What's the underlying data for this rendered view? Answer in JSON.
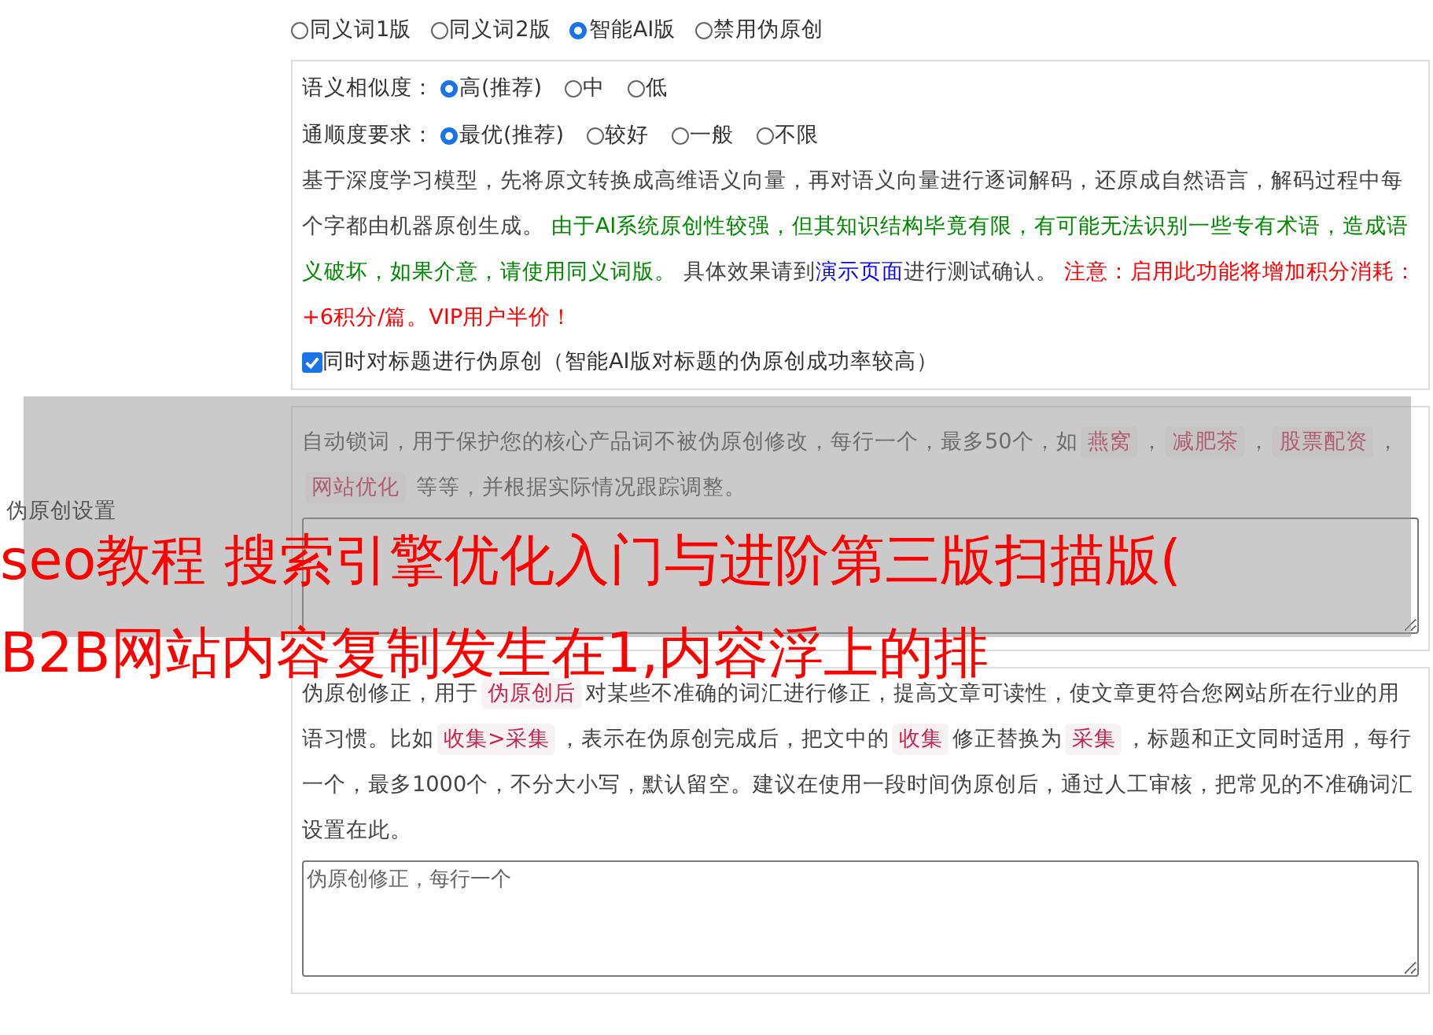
{
  "mode_options": [
    {
      "label": "同义词1版",
      "selected": false
    },
    {
      "label": "同义词2版",
      "selected": false
    },
    {
      "label": "智能AI版",
      "selected": true
    },
    {
      "label": "禁用伪原创",
      "selected": false
    }
  ],
  "similarity": {
    "label": "语义相似度：",
    "options": [
      {
        "label": "高(推荐)",
        "selected": true
      },
      {
        "label": "中",
        "selected": false
      },
      {
        "label": "低",
        "selected": false
      }
    ]
  },
  "fluency": {
    "label": "通顺度要求：",
    "options": [
      {
        "label": "最优(推荐)",
        "selected": true
      },
      {
        "label": "较好",
        "selected": false
      },
      {
        "label": "一般",
        "selected": false
      },
      {
        "label": "不限",
        "selected": false
      }
    ]
  },
  "description": [
    {
      "kind": "plain",
      "text": "基于深度学习模型，先将原文转换成高维语义向量，再对语义向量进行逐词解码，还原成自然语言，解码过程中每个字都由机器原创生成。 "
    },
    {
      "kind": "notice",
      "text": "由于AI系统原创性较强，但其知识结构毕竟有限，有可能无法识别一些专有术语，造成语义破坏，如果介意，请使用同义词版。"
    },
    {
      "kind": "plain",
      "text": " 具体效果请到"
    },
    {
      "kind": "link",
      "text": "演示页面"
    },
    {
      "kind": "plain",
      "text": "进行测试确认。 "
    },
    {
      "kind": "warning",
      "text": "注意：启用此功能将增加积分消耗：+6积分/篇。VIP用户半价！"
    }
  ],
  "title_checkbox": {
    "label": "同时对标题进行伪原创（智能AI版对标题的伪原创成功率较高）",
    "checked": true
  },
  "section_label": "伪原创设置",
  "lock_words": {
    "help": [
      {
        "kind": "plain",
        "text": "自动锁词，用于保护您的核心产品词不被伪原创修改，每行一个，最多50个，如"
      },
      {
        "kind": "tag",
        "text": "燕窝"
      },
      {
        "kind": "plain",
        "text": "，"
      },
      {
        "kind": "tag",
        "text": "减肥茶"
      },
      {
        "kind": "plain",
        "text": "，"
      },
      {
        "kind": "tag",
        "text": "股票配资"
      },
      {
        "kind": "plain",
        "text": "，"
      },
      {
        "kind": "tag",
        "text": "网站优化"
      },
      {
        "kind": "plain",
        "text": " 等等，并根据实际情况跟踪调整。"
      }
    ]
  },
  "correction": {
    "help": [
      {
        "kind": "plain",
        "text": "伪原创修正，用于"
      },
      {
        "kind": "tag",
        "text": "伪原创后"
      },
      {
        "kind": "plain",
        "text": "对某些不准确的词汇进行修正，提高文章可读性，使文章更符合您网站所在行业的用语习惯。比如"
      },
      {
        "kind": "tag",
        "text": "收集>采集"
      },
      {
        "kind": "plain",
        "text": "，表示在伪原创完成后，把文中的"
      },
      {
        "kind": "tag",
        "text": "收集"
      },
      {
        "kind": "plain",
        "text": "修正替换为"
      },
      {
        "kind": "tag",
        "text": "采集"
      },
      {
        "kind": "plain",
        "text": "，标题和正文同时适用，每行一个，最多1000个，不分大小写，默认留空。建议在使用一段时间伪原创后，通过人工审核，把常见的不准确词汇设置在此。"
      }
    ],
    "placeholder": "伪原创修正，每行一个"
  },
  "overlay": {
    "lines": [
      "seo教程 搜索引擎优化入门与进阶第三版扫描版(",
      "B2B网站内容复制发生在1,内容浮上的排"
    ]
  }
}
